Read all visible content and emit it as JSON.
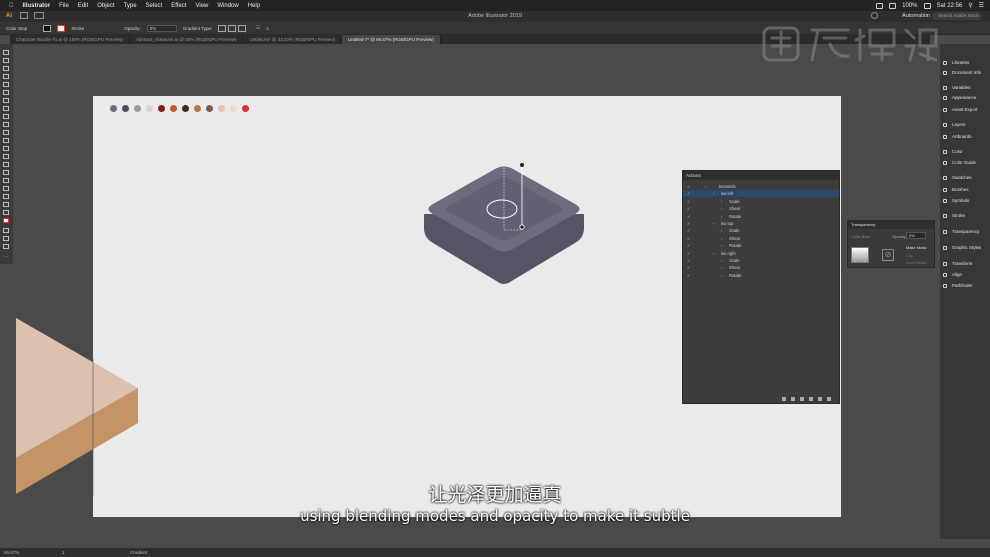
{
  "menubar": {
    "app_name": "Illustrator",
    "items": [
      "File",
      "Edit",
      "Object",
      "Type",
      "Select",
      "Effect",
      "View",
      "Window",
      "Help"
    ],
    "battery": "100%",
    "clock": "Sat 22:56"
  },
  "appbar": {
    "title": "Adobe Illustrator 2019",
    "workspace": "Automation",
    "search_placeholder": "Search Adobe Stock"
  },
  "control_bar": {
    "selection_label": "Color Stop",
    "stroke_label": "Stroke",
    "opacity_label": "Opacity:",
    "opacity_value": "0%",
    "gradient_type_label": "Gradient Type:"
  },
  "tabs": [
    {
      "label": "Character Bundle #1.ai @ 150% (RGB/GPU Preview)",
      "active": false
    },
    {
      "label": "Abstract_character.ai @ 50% (RGB/GPU Preview)",
      "active": false
    },
    {
      "label": "Untitled-6* @ 33.33% (RGB/GPU Preview)",
      "active": false
    },
    {
      "label": "Untitled-7* @ 66.67% (RGB/GPU Preview)",
      "active": true
    }
  ],
  "swatches": [
    "#6b6b7a",
    "#4b4b5c",
    "#9a9aa5",
    "#d9d6d0",
    "#7a1f1f",
    "#c25a2e",
    "#3a2b28",
    "#b07a52",
    "#7a5a48",
    "#e0c5b0",
    "#e8dcd3",
    "#d0333a"
  ],
  "dock": {
    "items": [
      "Libraries",
      "Document Info",
      "Variables",
      "Appearance",
      "Asset Export",
      "Layers",
      "Artboards",
      "Color",
      "Color Guide",
      "Swatches",
      "Brushes",
      "Symbols",
      "Stroke",
      "Transparency",
      "Graphic Styles",
      "Transform",
      "Align",
      "Pathfinder"
    ]
  },
  "actions_panel": {
    "title": "Actions",
    "rows": [
      {
        "label": "Isometric",
        "level": 0,
        "selected": false
      },
      {
        "label": "iso left",
        "level": 1,
        "selected": true
      },
      {
        "label": "Scale",
        "level": 2,
        "selected": false
      },
      {
        "label": "Shear",
        "level": 2,
        "selected": false
      },
      {
        "label": "Rotate",
        "level": 2,
        "selected": false
      },
      {
        "label": "iso top",
        "level": 1,
        "selected": false
      },
      {
        "label": "Scale",
        "level": 2,
        "selected": false
      },
      {
        "label": "Shear",
        "level": 2,
        "selected": false
      },
      {
        "label": "Rotate",
        "level": 2,
        "selected": false
      },
      {
        "label": "iso right",
        "level": 1,
        "selected": false
      },
      {
        "label": "Scale",
        "level": 2,
        "selected": false
      },
      {
        "label": "Shear",
        "level": 2,
        "selected": false
      },
      {
        "label": "Rotate",
        "level": 2,
        "selected": false
      }
    ]
  },
  "transparency_panel": {
    "title": "Transparency",
    "blend_mode": "Color Burn",
    "opacity_label": "Opacity:",
    "opacity_value": "0%",
    "make_mask": "Make Mask",
    "clip": "Clip",
    "invert_mask": "Invert Mask"
  },
  "status_bar": {
    "zoom": "66.67%",
    "page": "1",
    "tool": "Gradient"
  },
  "subtitles": {
    "chinese": "让光泽更加逼真",
    "english": "using blending modes and opacity to make it subtle"
  },
  "colors": {
    "artboard": "#eaeaea",
    "shape_top": "#6e6b7e",
    "shape_side": "#575467",
    "peach_light": "#dcc1ae",
    "peach_dark": "#c49467",
    "selection_blue": "#2d4a6e"
  }
}
